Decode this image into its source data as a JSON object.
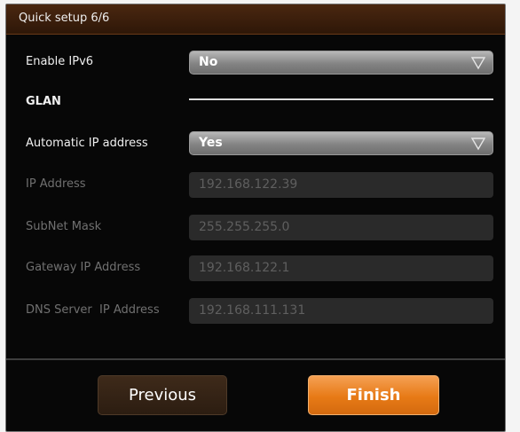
{
  "window": {
    "title": "Quick setup 6/6"
  },
  "form": {
    "enable_ipv6": {
      "label": "Enable IPv6",
      "value": "No"
    },
    "glan": {
      "label": "GLAN"
    },
    "automatic_ip": {
      "label": "Automatic IP address",
      "value": "Yes"
    },
    "ip_address": {
      "label": "IP Address",
      "value": "192.168.122.39"
    },
    "subnet_mask": {
      "label": "SubNet Mask",
      "value": "255.255.255.0"
    },
    "gateway_ip": {
      "label": "Gateway IP Address",
      "value": "192.168.122.1"
    },
    "dns_server_ip": {
      "label": "DNS Server  IP Address",
      "value": "192.168.111.131"
    }
  },
  "buttons": {
    "previous": "Previous",
    "finish": "Finish"
  },
  "icons": {
    "dropdown": "chevron-down-icon"
  },
  "colors": {
    "accent": "#e77a16",
    "titlebar": "#3b1f0c",
    "background": "#070707"
  }
}
